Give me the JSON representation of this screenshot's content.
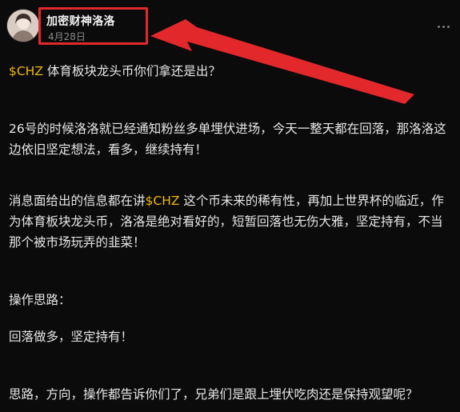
{
  "post": {
    "author_name": "加密财神洛洛",
    "date": "4月28日",
    "paragraphs": [
      {
        "cashtag": "$CHZ",
        "text_after": " 体育板块龙头币你们拿还是出？"
      },
      {
        "text": "26号的时候洛洛就已经通知粉丝多单埋伏进场，今天一整天都在回落，那洛洛这边依旧坚定想法，看多，继续持有！"
      },
      {
        "text_before": "消息面给出的信息都在讲",
        "cashtag": "$CHZ",
        "text_after": " 这个币未来的稀有性，再加上世界杯的临近，作为体育板块龙头币，洛洛是绝对看好的，短暂回落也无伤大雅，坚定持有，不当那个被市场玩弄的韭菜！"
      },
      {
        "text": "操作思路："
      },
      {
        "text": "回落做多，坚定持有！"
      },
      {
        "text": "思路，方向，操作都告诉你们了，兄弟们是跟上埋伏吃肉还是保持观望呢？"
      }
    ]
  },
  "colors": {
    "background": "#0b0b0b",
    "cashtag": "#f0b90b",
    "highlight_box": "#e3282c",
    "arrow": "#e3282c"
  },
  "icons": {
    "more": "more-dots-icon",
    "arrow": "red-arrow-annotation"
  }
}
